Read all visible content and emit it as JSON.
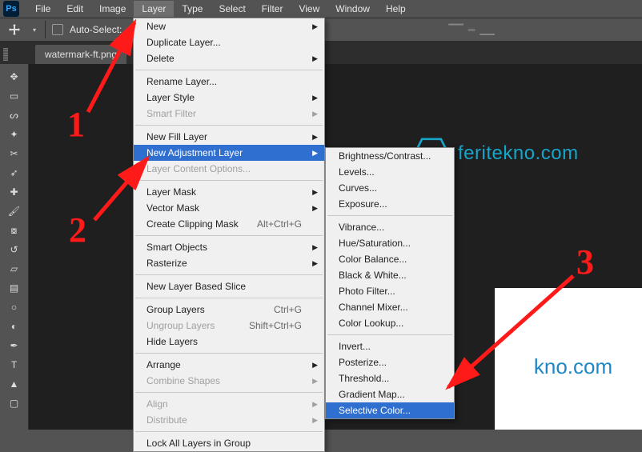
{
  "menubar": {
    "items": [
      "File",
      "Edit",
      "Image",
      "Layer",
      "Type",
      "Select",
      "Filter",
      "View",
      "Window",
      "Help"
    ],
    "active_index": 3
  },
  "options_bar": {
    "auto_select_label": "Auto-Select:"
  },
  "document_tab": "watermark-ft.png",
  "canvas": {
    "brand_text": "feritekno.com",
    "card_text": "kno.com"
  },
  "layer_menu": [
    {
      "label": "New",
      "sub": true
    },
    {
      "label": "Duplicate Layer..."
    },
    {
      "label": "Delete",
      "sub": true
    },
    {
      "sep": true
    },
    {
      "label": "Rename Layer..."
    },
    {
      "label": "Layer Style",
      "sub": true
    },
    {
      "label": "Smart Filter",
      "sub": true,
      "disabled": true
    },
    {
      "sep": true
    },
    {
      "label": "New Fill Layer",
      "sub": true
    },
    {
      "label": "New Adjustment Layer",
      "sub": true,
      "highlight": true
    },
    {
      "label": "Layer Content Options...",
      "disabled": true
    },
    {
      "sep": true
    },
    {
      "label": "Layer Mask",
      "sub": true
    },
    {
      "label": "Vector Mask",
      "sub": true
    },
    {
      "label": "Create Clipping Mask",
      "shortcut": "Alt+Ctrl+G"
    },
    {
      "sep": true
    },
    {
      "label": "Smart Objects",
      "sub": true
    },
    {
      "label": "Rasterize",
      "sub": true
    },
    {
      "sep": true
    },
    {
      "label": "New Layer Based Slice"
    },
    {
      "sep": true
    },
    {
      "label": "Group Layers",
      "shortcut": "Ctrl+G"
    },
    {
      "label": "Ungroup Layers",
      "shortcut": "Shift+Ctrl+G",
      "disabled": true
    },
    {
      "label": "Hide Layers"
    },
    {
      "sep": true
    },
    {
      "label": "Arrange",
      "sub": true
    },
    {
      "label": "Combine Shapes",
      "sub": true,
      "disabled": true
    },
    {
      "sep": true
    },
    {
      "label": "Align",
      "sub": true,
      "disabled": true
    },
    {
      "label": "Distribute",
      "sub": true,
      "disabled": true
    },
    {
      "sep": true
    },
    {
      "label": "Lock All Layers in Group"
    }
  ],
  "adjustment_menu": [
    {
      "label": "Brightness/Contrast..."
    },
    {
      "label": "Levels..."
    },
    {
      "label": "Curves..."
    },
    {
      "label": "Exposure..."
    },
    {
      "sep": true
    },
    {
      "label": "Vibrance..."
    },
    {
      "label": "Hue/Saturation..."
    },
    {
      "label": "Color Balance..."
    },
    {
      "label": "Black & White..."
    },
    {
      "label": "Photo Filter..."
    },
    {
      "label": "Channel Mixer..."
    },
    {
      "label": "Color Lookup..."
    },
    {
      "sep": true
    },
    {
      "label": "Invert..."
    },
    {
      "label": "Posterize..."
    },
    {
      "label": "Threshold..."
    },
    {
      "label": "Gradient Map..."
    },
    {
      "label": "Selective Color...",
      "highlight": true
    }
  ],
  "annotations": {
    "n1": "1",
    "n2": "2",
    "n3": "3"
  },
  "tools": [
    "move",
    "rect-marquee",
    "lasso",
    "magic-wand",
    "crop",
    "eyedropper",
    "spot-heal",
    "brush",
    "clone-stamp",
    "history-brush",
    "eraser",
    "gradient",
    "blur",
    "dodge",
    "pen",
    "type",
    "path-select",
    "rectangle"
  ]
}
